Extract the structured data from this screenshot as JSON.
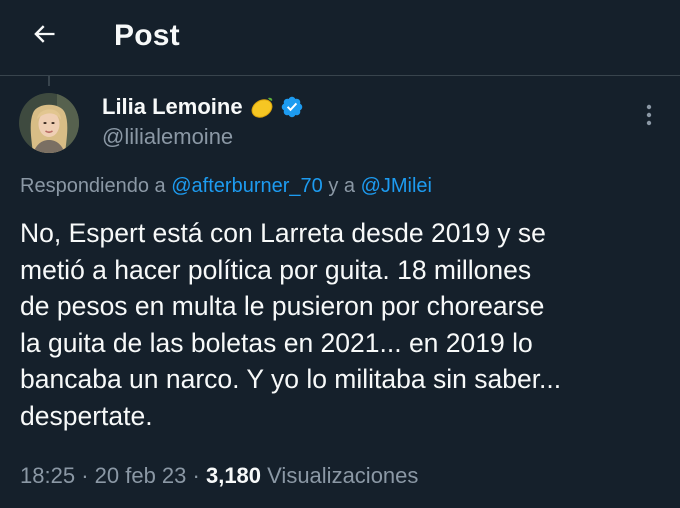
{
  "header": {
    "title": "Post"
  },
  "tweet": {
    "author_name": "Lilia Lemoine",
    "author_handle": "@lilialemoine",
    "reply_prefix": "Respondiendo a",
    "reply_mention_1": "@afterburner_70",
    "reply_joiner": "y a",
    "reply_mention_2": "@JMilei",
    "text_lines": [
      "No, Espert está con Larreta desde 2019 y se",
      "metió a hacer política por guita. 18 millones",
      "de pesos en multa le pusieron por chorearse",
      "la guita de las boletas en 2021... en 2019 lo",
      "bancaba un narco. Y yo lo militaba sin saber...",
      "despertate."
    ],
    "time": "18:25",
    "separator": "·",
    "date": "20 feb 23",
    "views_count": "3,180",
    "views_label": "Visualizaciones"
  },
  "icons": {
    "back": "arrow-left-icon",
    "more": "more-vertical-icon",
    "verified": "verified-badge-icon",
    "emoji": "lemon-emoji-icon"
  },
  "colors": {
    "background": "#15202b",
    "primary_text": "#f7f9f9",
    "secondary_text": "#8b98a5",
    "accent": "#1d9bf0",
    "divider": "#38444d"
  }
}
